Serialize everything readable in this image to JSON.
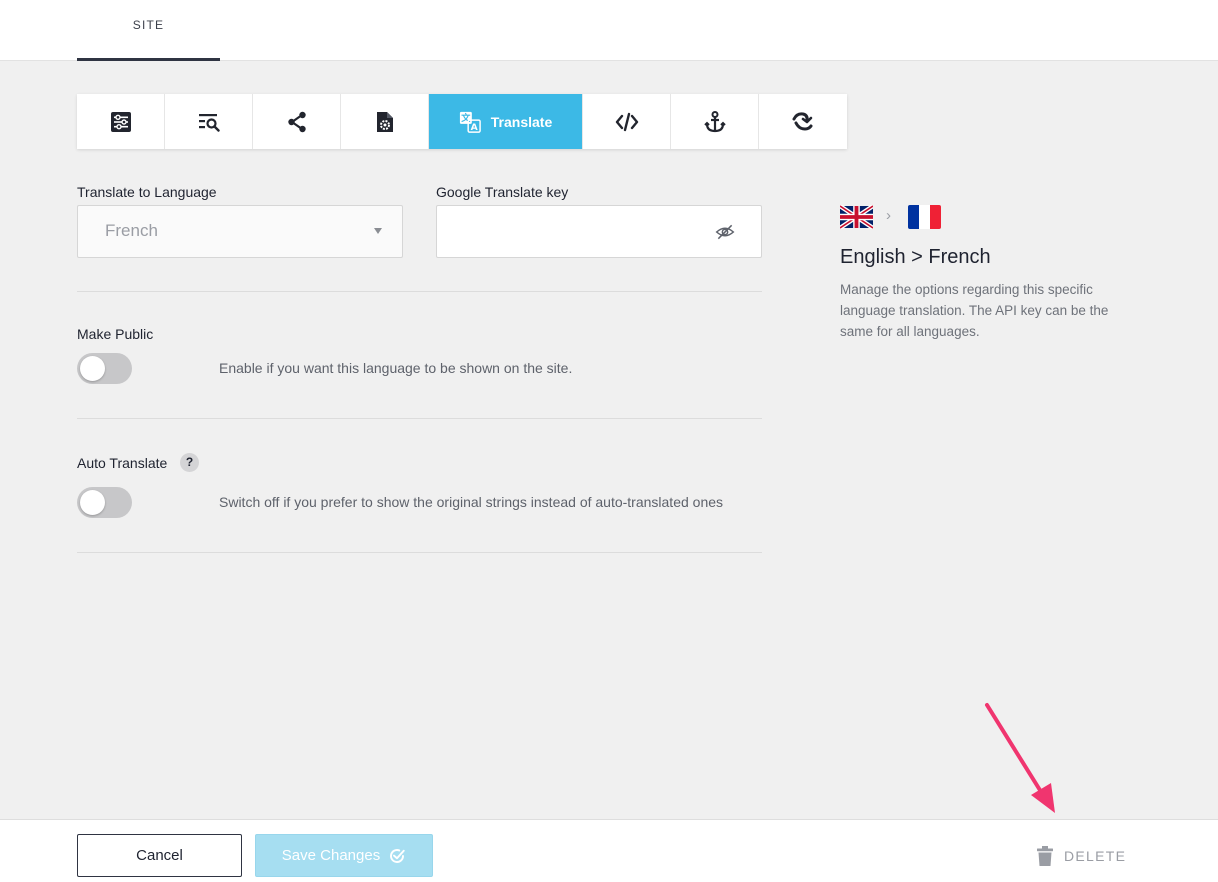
{
  "top_tab": {
    "label": "SITE"
  },
  "toolbar": {
    "items": [
      {
        "icon": "sliders-icon"
      },
      {
        "icon": "search-list-icon"
      },
      {
        "icon": "share-icon"
      },
      {
        "icon": "file-settings-icon"
      },
      {
        "icon": "translate-icon",
        "label": "Translate",
        "active": true
      },
      {
        "icon": "code-icon"
      },
      {
        "icon": "anchor-icon"
      },
      {
        "icon": "redirect-icon"
      }
    ],
    "active_color": "#3cb9e6"
  },
  "form": {
    "language_label": "Translate to Language",
    "language_value": "French",
    "key_label": "Google Translate key",
    "key_value": "",
    "make_public": {
      "label": "Make Public",
      "description": "Enable if you want this language to be shown on the site.",
      "enabled": false
    },
    "auto_translate": {
      "label": "Auto Translate",
      "help": "?",
      "description": "Switch off if you prefer to show the original strings instead of auto-translated ones",
      "enabled": false
    }
  },
  "sidebar": {
    "chevron": "›",
    "title": "English > French",
    "description": "Manage the options regarding this specific language translation. The API key can be the same for all languages."
  },
  "footer": {
    "cancel_label": "Cancel",
    "save_label": "Save Changes",
    "delete_label": "DELETE"
  },
  "colors": {
    "arrow": "#f0356f",
    "save_disabled": "#a6def1"
  }
}
